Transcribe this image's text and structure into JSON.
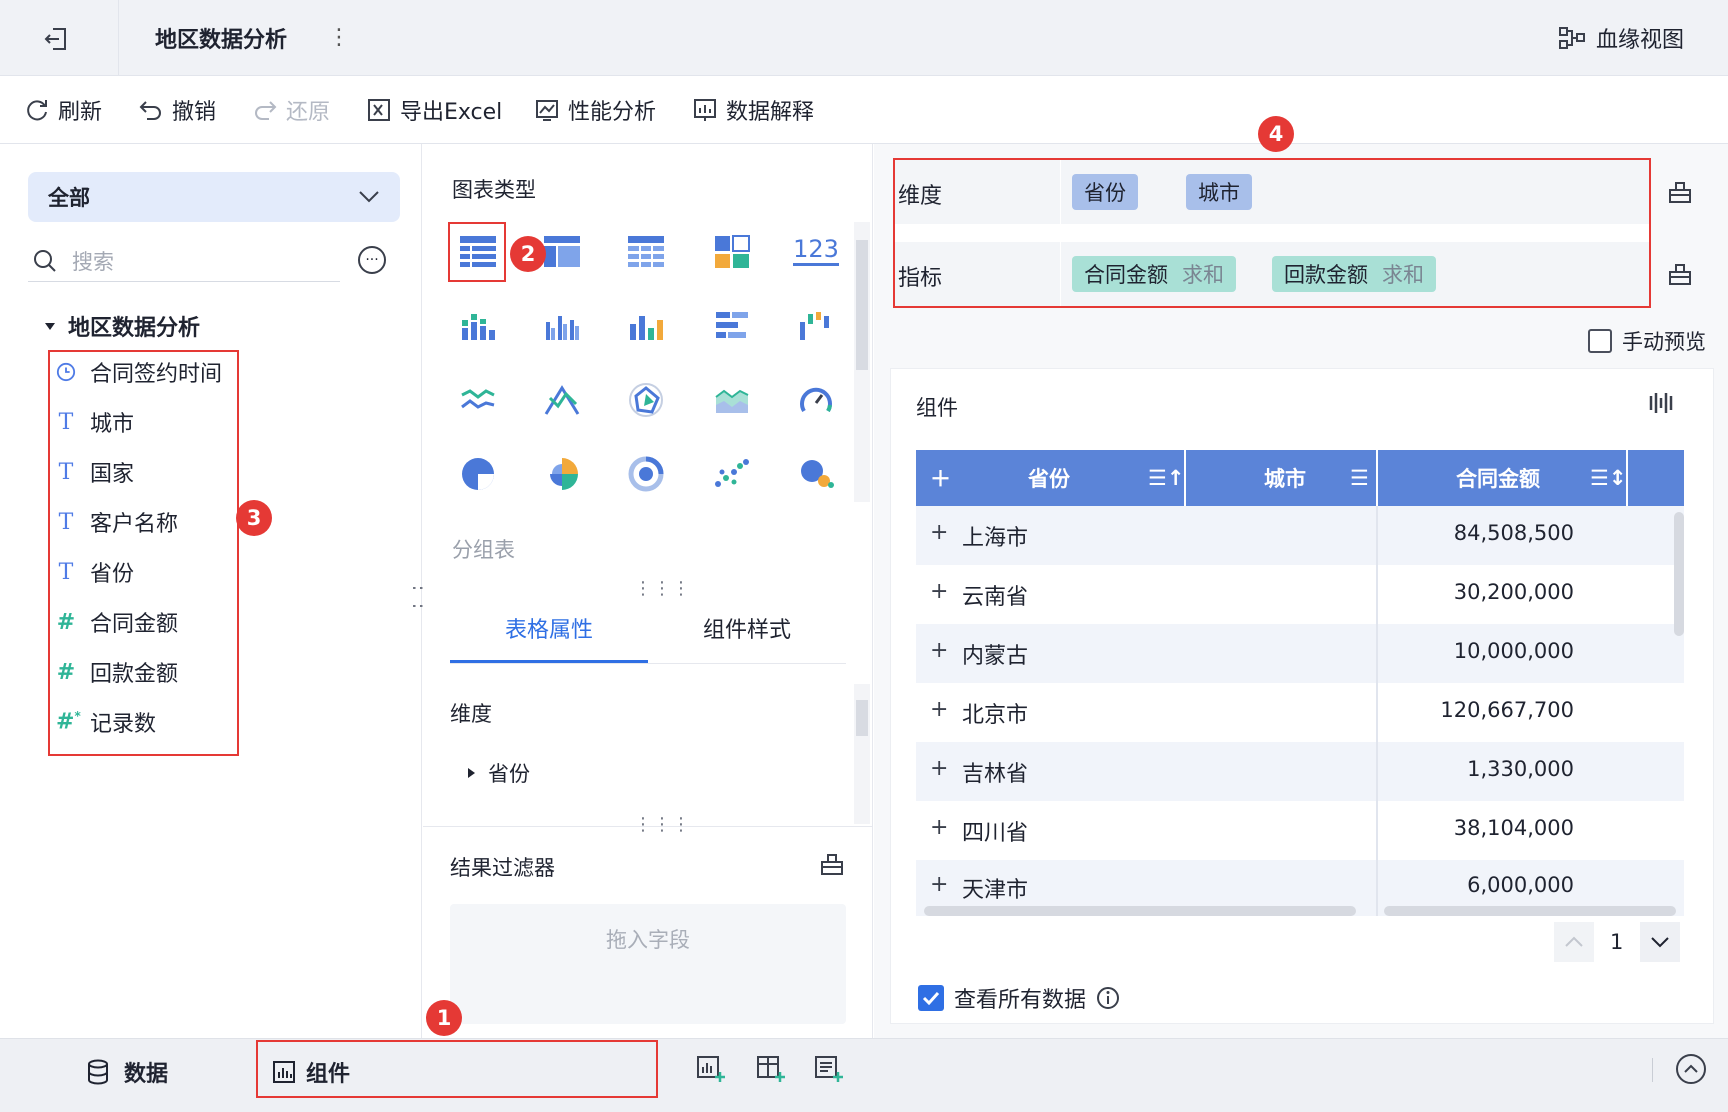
{
  "title_bar": {
    "title": "地区数据分析",
    "lineage_label": "血缘视图"
  },
  "toolbar": {
    "refresh": "刷新",
    "undo": "撤销",
    "redo": "还原",
    "export_excel": "导出Excel",
    "performance": "性能分析",
    "data_explain": "数据解释"
  },
  "left_panel": {
    "scope_select": "全部",
    "search_placeholder": "搜索",
    "tree_root": "地区数据分析",
    "fields": [
      {
        "name": "合同签约时间",
        "type": "date"
      },
      {
        "name": "城市",
        "type": "text"
      },
      {
        "name": "国家",
        "type": "text"
      },
      {
        "name": "客户名称",
        "type": "text"
      },
      {
        "name": "省份",
        "type": "text"
      },
      {
        "name": "合同金额",
        "type": "number"
      },
      {
        "name": "回款金额",
        "type": "number"
      },
      {
        "name": "记录数",
        "type": "count"
      }
    ]
  },
  "middle_panel": {
    "chart_type_title": "图表类型",
    "number_chart_label": "123",
    "group_table_label": "分组表",
    "tabs": [
      "表格属性",
      "组件样式"
    ],
    "dimension_label": "维度",
    "dimension_item": "省份",
    "filter_title": "结果过滤器",
    "drop_hint": "拖入字段"
  },
  "right_panel": {
    "dimension_shelf_label": "维度",
    "dimension_pills": [
      "省份",
      "城市"
    ],
    "measure_shelf_label": "指标",
    "measure_pills": [
      {
        "field": "合同金额",
        "agg": "求和"
      },
      {
        "field": "回款金额",
        "agg": "求和"
      }
    ],
    "manual_preview": "手动预览",
    "component_title": "组件",
    "table": {
      "columns": [
        "省份",
        "城市",
        "合同金额"
      ],
      "rows": [
        {
          "province": "上海市",
          "amount": "84,508,500"
        },
        {
          "province": "云南省",
          "amount": "30,200,000"
        },
        {
          "province": "内蒙古",
          "amount": "10,000,000"
        },
        {
          "province": "北京市",
          "amount": "120,667,700"
        },
        {
          "province": "吉林省",
          "amount": "1,330,000"
        },
        {
          "province": "四川省",
          "amount": "38,104,000"
        },
        {
          "province": "天津市",
          "amount": "6,000,000"
        }
      ]
    },
    "page_number": "1",
    "view_all_label": "查看所有数据"
  },
  "bottom_bar": {
    "data_tab": "数据",
    "component_tab": "组件"
  },
  "annotations": [
    "1",
    "2",
    "3",
    "4"
  ],
  "colors": {
    "accent": "#2f6fe4",
    "table_header": "#5b84d8",
    "dimension_pill": "#a8bfea",
    "measure_pill": "#a9e0d6",
    "highlight_box": "#e53935"
  }
}
